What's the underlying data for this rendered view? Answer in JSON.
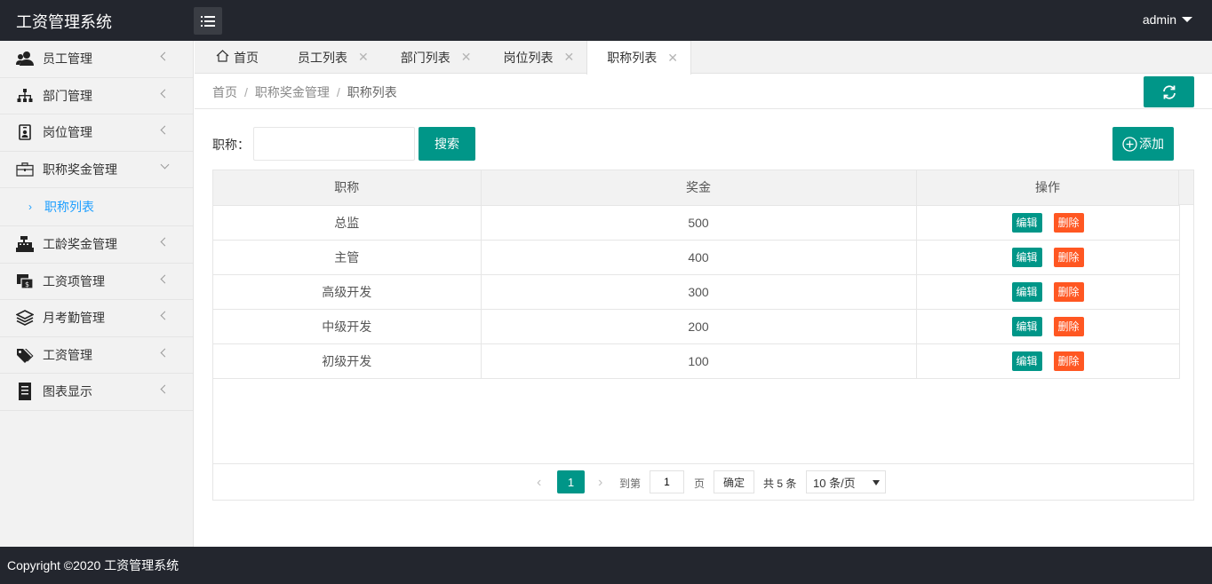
{
  "app": {
    "title": "工资管理系统",
    "user": "admin"
  },
  "colors": {
    "accent": "#009688",
    "danger": "#ff5722",
    "link": "#1e9fff",
    "header_bg": "#23262e"
  },
  "sidebar": {
    "items": [
      {
        "label": "员工管理",
        "icon": "users-icon"
      },
      {
        "label": "部门管理",
        "icon": "sitemap-icon"
      },
      {
        "label": "岗位管理",
        "icon": "id-badge-icon"
      },
      {
        "label": "职称奖金管理",
        "icon": "briefcase-icon",
        "expanded": true,
        "children": [
          {
            "label": "职称列表"
          }
        ]
      },
      {
        "label": "工龄奖金管理",
        "icon": "cash-register-icon"
      },
      {
        "label": "工资项管理",
        "icon": "money-bill-icon"
      },
      {
        "label": "月考勤管理",
        "icon": "layers-icon"
      },
      {
        "label": "工资管理",
        "icon": "tags-icon"
      },
      {
        "label": "图表显示",
        "icon": "receipt-icon"
      }
    ]
  },
  "tabs": [
    {
      "label": "首页"
    },
    {
      "label": "员工列表"
    },
    {
      "label": "部门列表"
    },
    {
      "label": "岗位列表"
    },
    {
      "label": "职称列表",
      "active": true
    }
  ],
  "breadcrumb": {
    "items": [
      "首页",
      "职称奖金管理",
      "职称列表"
    ]
  },
  "search": {
    "label": "职称：",
    "value": "",
    "placeholder": "",
    "button": "搜索"
  },
  "add_button": "添加",
  "table": {
    "columns": [
      "职称",
      "奖金",
      "操作"
    ],
    "rows": [
      {
        "title": "总监",
        "bonus": "500"
      },
      {
        "title": "主管",
        "bonus": "400"
      },
      {
        "title": "高级开发",
        "bonus": "300"
      },
      {
        "title": "中级开发",
        "bonus": "200"
      },
      {
        "title": "初级开发",
        "bonus": "100"
      }
    ],
    "edit_label": "编辑",
    "delete_label": "删除"
  },
  "pager": {
    "current": "1",
    "goto_label": "到第",
    "goto_value": "1",
    "page_label": "页",
    "ok_label": "确定",
    "total": "共 5 条",
    "page_size": "10 条/页"
  },
  "footer": {
    "text": "Copyright ©2020 工资管理系统"
  }
}
